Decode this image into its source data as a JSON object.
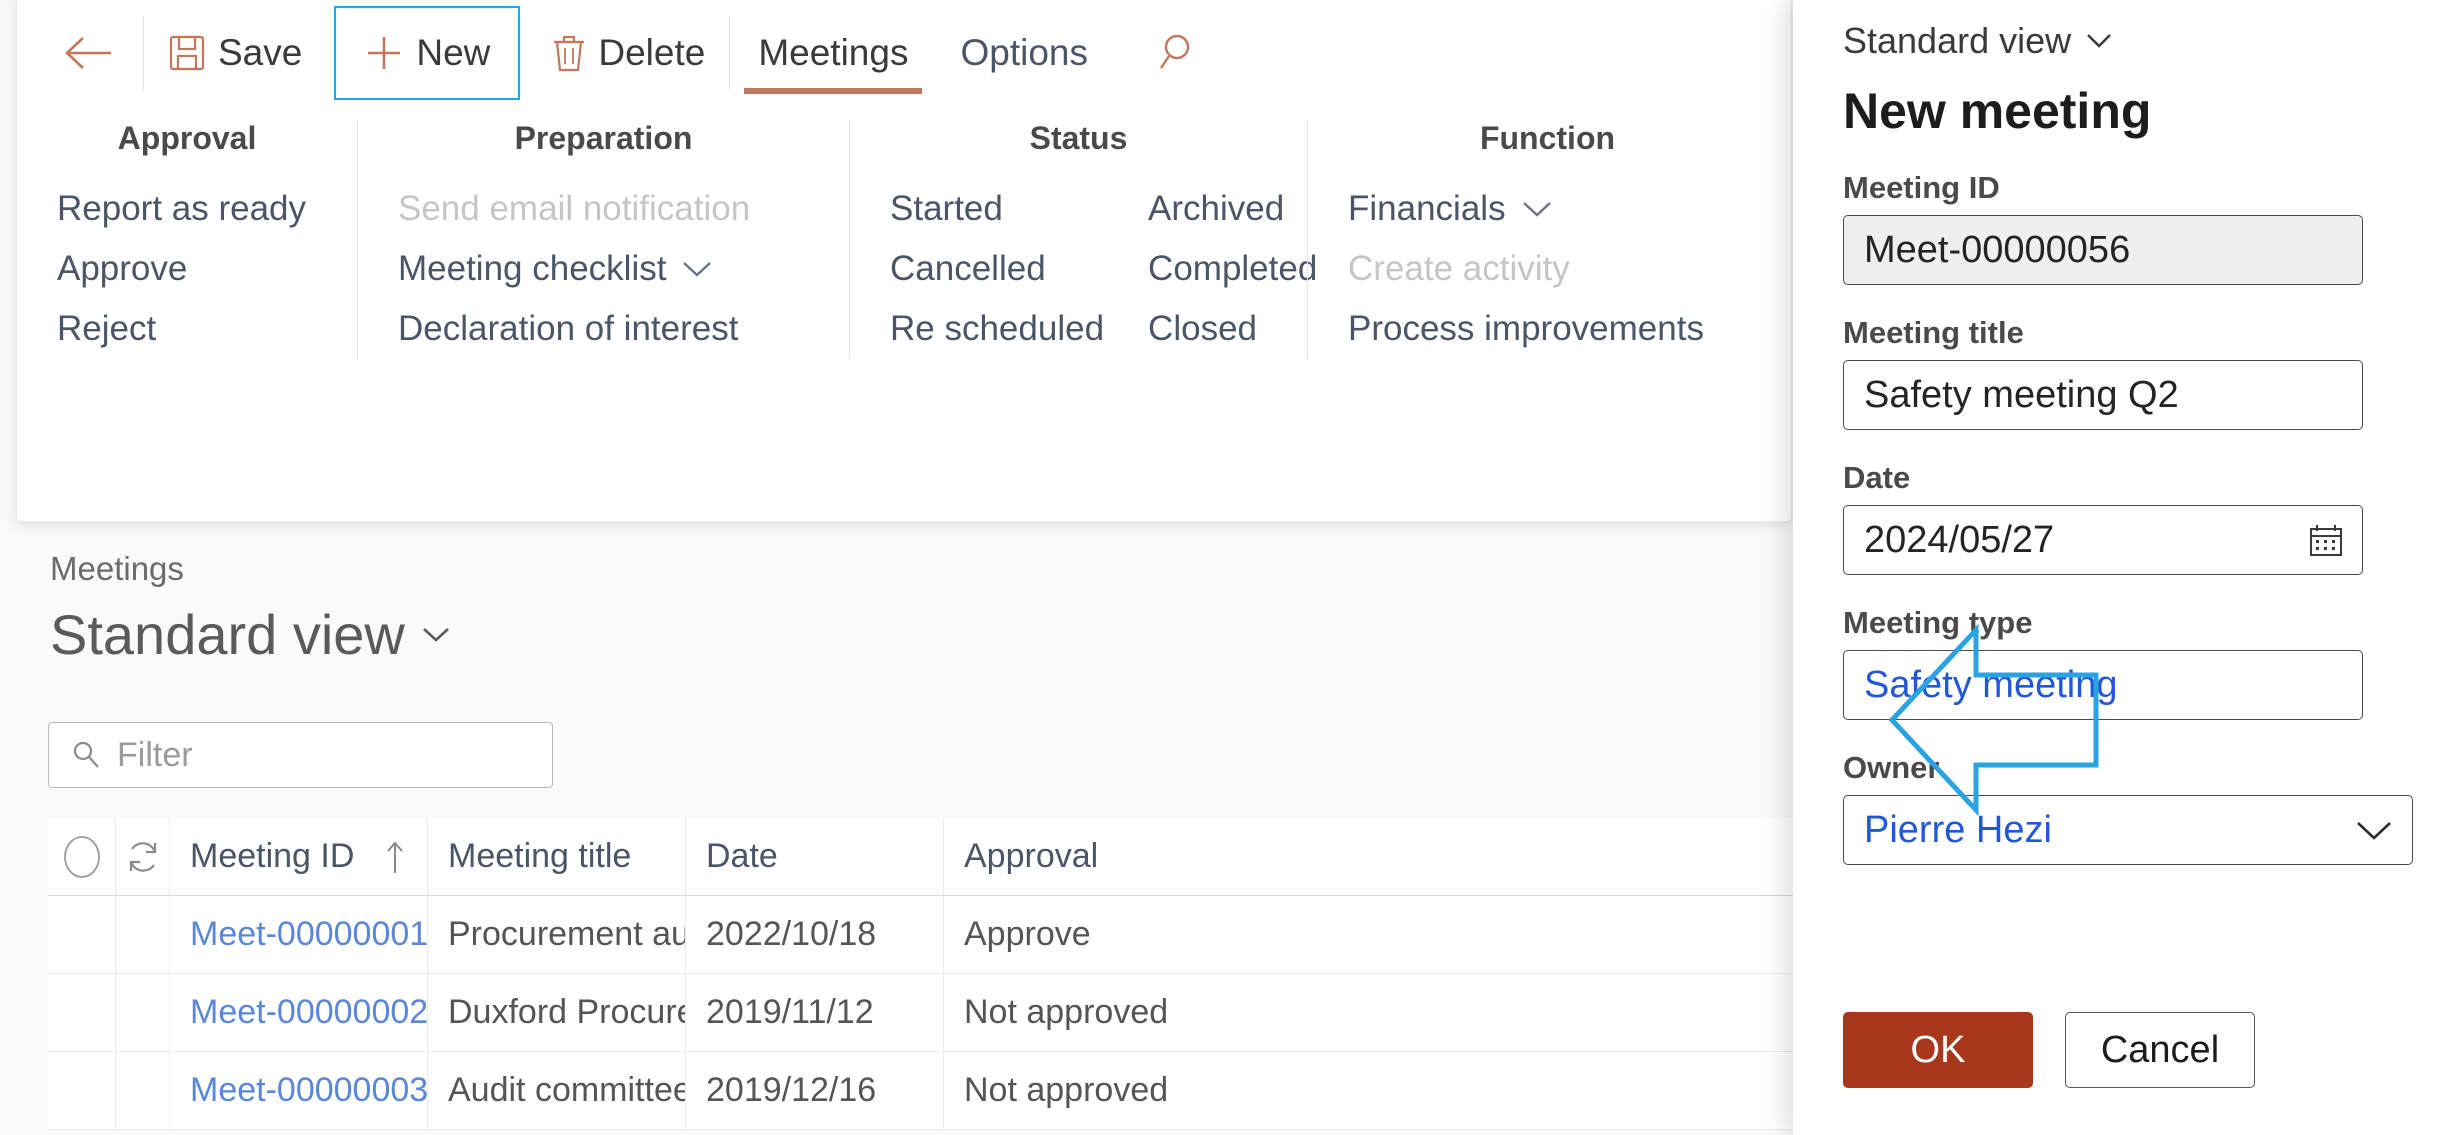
{
  "toolbar": {
    "back_label": "",
    "save_label": "Save",
    "new_label": "New",
    "delete_label": "Delete",
    "tabs": [
      {
        "label": "Meetings",
        "active": true
      },
      {
        "label": "Options",
        "active": false
      }
    ],
    "search_label": ""
  },
  "ribbon": {
    "groups": [
      {
        "title": "Approval",
        "items": [
          {
            "label": "Report as ready",
            "disabled": false,
            "chevron": false
          },
          {
            "label": "Approve",
            "disabled": false,
            "chevron": false
          },
          {
            "label": "Reject",
            "disabled": false,
            "chevron": false
          }
        ]
      },
      {
        "title": "Preparation",
        "items": [
          {
            "label": "Send email notification",
            "disabled": true,
            "chevron": false
          },
          {
            "label": "Meeting checklist",
            "disabled": false,
            "chevron": true
          },
          {
            "label": "Declaration of interest",
            "disabled": false,
            "chevron": false
          }
        ]
      },
      {
        "title": "Status",
        "col1": [
          {
            "label": "Started",
            "disabled": false,
            "chevron": false
          },
          {
            "label": "Cancelled",
            "disabled": false,
            "chevron": false
          },
          {
            "label": "Re scheduled",
            "disabled": false,
            "chevron": false
          }
        ],
        "col2": [
          {
            "label": "Archived",
            "disabled": false,
            "chevron": false
          },
          {
            "label": "Completed",
            "disabled": false,
            "chevron": false
          },
          {
            "label": "Closed",
            "disabled": false,
            "chevron": false
          }
        ]
      },
      {
        "title": "Function",
        "items": [
          {
            "label": "Financials",
            "disabled": false,
            "chevron": true
          },
          {
            "label": "Create activity",
            "disabled": true,
            "chevron": false
          },
          {
            "label": "Process improvements",
            "disabled": false,
            "chevron": false
          }
        ]
      }
    ]
  },
  "list_page": {
    "breadcrumb": "Meetings",
    "title": "Standard view",
    "filter_placeholder": "Filter",
    "columns": [
      {
        "key": "select",
        "label": ""
      },
      {
        "key": "refresh",
        "label": ""
      },
      {
        "key": "id",
        "label": "Meeting ID",
        "sort": "asc"
      },
      {
        "key": "title",
        "label": "Meeting title"
      },
      {
        "key": "date",
        "label": "Date"
      },
      {
        "key": "approval",
        "label": "Approval"
      }
    ],
    "rows": [
      {
        "id": "Meet-00000001",
        "title": "Procurement audit",
        "date": "2022/10/18",
        "approval": "Approve"
      },
      {
        "id": "Meet-00000002",
        "title": "Duxford Procure",
        "date": "2019/11/12",
        "approval": "Not approved"
      },
      {
        "id": "Meet-00000003",
        "title": "Audit committee",
        "date": "2019/12/16",
        "approval": "Not approved"
      }
    ]
  },
  "side_panel": {
    "view_label": "Standard view",
    "title": "New meeting",
    "fields": [
      {
        "label": "Meeting ID",
        "value": "Meet-00000056",
        "readonly": true,
        "kind": "text"
      },
      {
        "label": "Meeting title",
        "value": "Safety meeting Q2",
        "readonly": false,
        "kind": "text"
      },
      {
        "label": "Date",
        "value": "2024/05/27",
        "readonly": false,
        "kind": "date"
      },
      {
        "label": "Meeting type",
        "value": "Safety meeting",
        "readonly": false,
        "kind": "lookup"
      },
      {
        "label": "Owner",
        "value": "Pierre Hezi",
        "readonly": false,
        "kind": "dropdown"
      }
    ],
    "ok_label": "OK",
    "cancel_label": "Cancel"
  },
  "annotation": {
    "arrow_direction": "left",
    "arrow_color": "#2aa3e0",
    "points_at": "Meeting type"
  },
  "colors": {
    "accent": "#c1775c",
    "primary_button": "#a8371b",
    "link": "#5b87d8",
    "lookup_text": "#2058d8",
    "highlight_outline": "#2aa3e0"
  }
}
